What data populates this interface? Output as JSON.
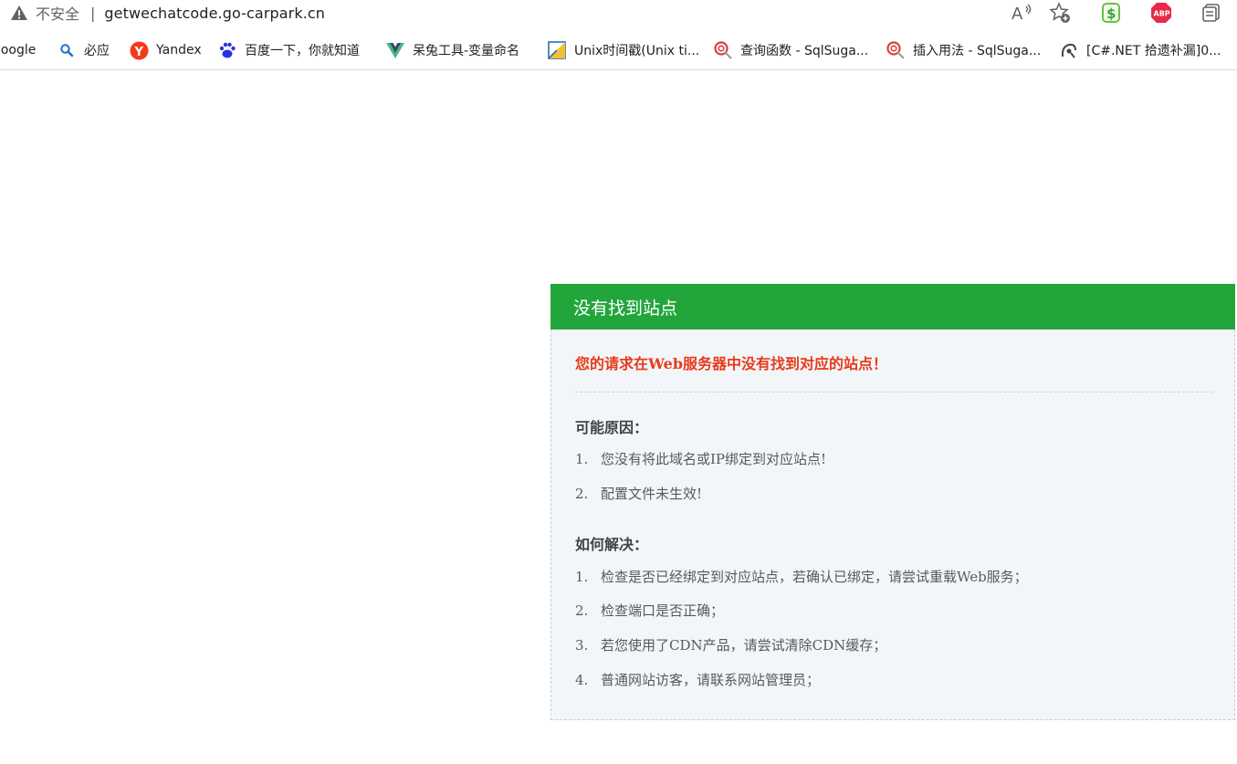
{
  "browser": {
    "security_label": "不安全",
    "separator": "|",
    "url": "getwechatcode.go-carpark.cn",
    "toolbar_icons": [
      "read-aloud-icon",
      "add-favorite-icon"
    ],
    "extensions": [
      {
        "name": "dollar-extension-icon",
        "label": "$",
        "color": "#3aa43a"
      },
      {
        "name": "adblock-plus-icon",
        "label": "ABP",
        "color": "#e8294a"
      },
      {
        "name": "collections-icon",
        "label": ""
      }
    ]
  },
  "bookmarks": [
    {
      "label": "Google",
      "icon": "google-icon"
    },
    {
      "label": "必应",
      "icon": "bing-search-icon"
    },
    {
      "label": "Yandex",
      "icon": "yandex-icon"
    },
    {
      "label": "百度一下，你就知道",
      "icon": "baidu-paw-icon"
    },
    {
      "label": "呆兔工具-变量命名",
      "icon": "vue-icon"
    },
    {
      "label": "Unix时间戳(Unix ti...",
      "icon": "unix-clock-icon"
    },
    {
      "label": "查询函数 - SqlSuga...",
      "icon": "sqlsugar-icon"
    },
    {
      "label": "插入用法 - SqlSuga...",
      "icon": "sqlsugar-icon"
    },
    {
      "label": "[C#.NET 拾遗补漏]0...",
      "icon": "cnblogs-icon"
    }
  ],
  "panel": {
    "title": "没有找到站点",
    "error_message": "您的请求在Web服务器中没有找到对应的站点！",
    "reasons_title": "可能原因：",
    "reasons": [
      {
        "num": "1.",
        "text": "您没有将此域名或IP绑定到对应站点!"
      },
      {
        "num": "2.",
        "text": "配置文件未生效!"
      }
    ],
    "solutions_title": "如何解决：",
    "solutions": [
      {
        "num": "1.",
        "text": "检查是否已经绑定到对应站点，若确认已绑定，请尝试重载Web服务；"
      },
      {
        "num": "2.",
        "text": "检查端口是否正确；"
      },
      {
        "num": "3.",
        "text": "若您使用了CDN产品，请尝试清除CDN缓存；"
      },
      {
        "num": "4.",
        "text": "普通网站访客，请联系网站管理员；"
      }
    ],
    "colors": {
      "header": "#22a63c",
      "error": "#e8391a",
      "body_bg": "#f3f6f8"
    }
  }
}
